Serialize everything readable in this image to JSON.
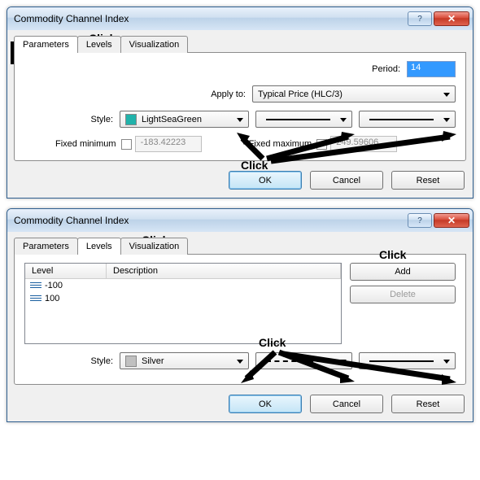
{
  "dialog1": {
    "title": "Commodity Channel Index",
    "tabs": {
      "parameters": "Parameters",
      "levels": "Levels",
      "visualization": "Visualization"
    },
    "highlight_tab_label": "Click",
    "period_label": "Period:",
    "period_value": "14",
    "apply_label": "Apply to:",
    "apply_value": "Typical Price (HLC/3)",
    "style_label": "Style:",
    "style_color_name": "LightSeaGreen",
    "style_color_hex": "#20B2AA",
    "fixed_min_label": "Fixed minimum",
    "fixed_min_value": "-183.42223",
    "fixed_max_label": "Fixed maximum",
    "fixed_max_value": "249.59606",
    "click_text": "Click",
    "buttons": {
      "ok": "OK",
      "cancel": "Cancel",
      "reset": "Reset"
    }
  },
  "dialog2": {
    "title": "Commodity Channel Index",
    "tabs": {
      "parameters": "Parameters",
      "levels": "Levels",
      "visualization": "Visualization"
    },
    "highlight_tab_label": "Click",
    "columns": {
      "level": "Level",
      "description": "Description"
    },
    "rows": [
      {
        "level": "-100",
        "description": ""
      },
      {
        "level": "100",
        "description": ""
      }
    ],
    "add_label": "Add",
    "delete_label": "Delete",
    "click_label_right": "Click",
    "style_label": "Style:",
    "style_color_name": "Silver",
    "style_color_hex": "#C0C0C0",
    "click_text": "Click",
    "buttons": {
      "ok": "OK",
      "cancel": "Cancel",
      "reset": "Reset"
    }
  }
}
